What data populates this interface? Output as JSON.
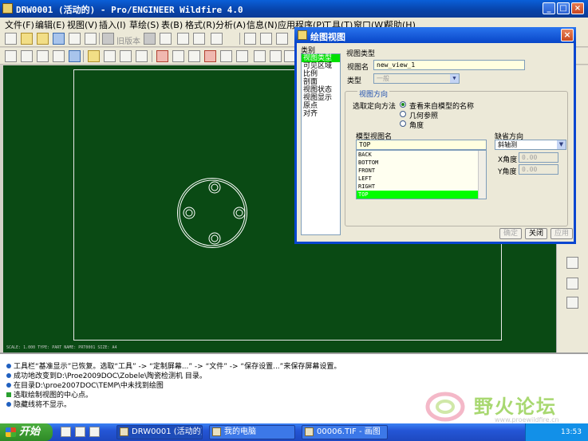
{
  "window": {
    "title": "DRW0001 (活动的) - Pro/ENGINEER Wildfire 4.0"
  },
  "menu": [
    "文件(F)",
    "编辑(E)",
    "视图(V)",
    "插入(I)",
    "草绘(S)",
    "表(B)",
    "格式(R)",
    "分析(A)",
    "信息(N)",
    "应用程序(P)",
    "工具(T)",
    "窗口(W)",
    "帮助(H)"
  ],
  "toolbar": {
    "revision_label": "旧版本"
  },
  "canvas": {
    "status_text": "SCALE: 1.000   TYPE: PART   NAME: PRT0001   SIZE: A4"
  },
  "dialog": {
    "title": "绘图视图",
    "category_label": "类别",
    "categories": [
      "视图类型",
      "可见区域",
      "比例",
      "剖面",
      "视图状态",
      "视图显示",
      "原点",
      "对齐"
    ],
    "selected_category": 0,
    "section_view_type": "视图类型",
    "view_name_label": "视图名",
    "view_name_value": "new_view_1",
    "type_label": "类型",
    "type_value": "一般",
    "orientation_group": "视图方向",
    "orientation_method_label": "选取定向方法",
    "orientation_options": [
      "查看来自模型的名称",
      "几何参照",
      "角度"
    ],
    "selected_orientation": 0,
    "model_view_name_label": "模型视图名",
    "model_view_value": "TOP",
    "model_views": [
      "BACK",
      "BOTTOM",
      "FRONT",
      "LEFT",
      "RIGHT",
      "TOP"
    ],
    "selected_model_view": 5,
    "default_orientation_label": "缺省方向",
    "default_orientation_value": "斜轴测",
    "x_angle_label": "X角度",
    "x_angle_value": "0.00",
    "y_angle_label": "Y角度",
    "y_angle_value": "0.00",
    "btn_ok": "确定",
    "btn_close": "关闭",
    "btn_apply": "应用"
  },
  "messages": [
    "工具栏“基准显示”已恢复。选取“工具” -> “定制屏幕...” -> “文件” -> “保存设置...”来保存屏幕设置。",
    "成功地改变到D:\\Proe2009DOC\\Zobele\\陶瓷检测机 目录。",
    "在目录D:\\proe2007DOC\\TEMP\\中未找到绘图",
    "选取绘制视图的中心点。",
    "隐藏线将不显示。"
  ],
  "watermark": {
    "text": "野火论坛",
    "url": "www.proewildfire.cn"
  },
  "taskbar": {
    "start": "开始",
    "tasks": [
      "DRW0001 (活动的)...",
      "我的电脑",
      "00006.TIF - 画图"
    ],
    "clock": "13:53"
  }
}
